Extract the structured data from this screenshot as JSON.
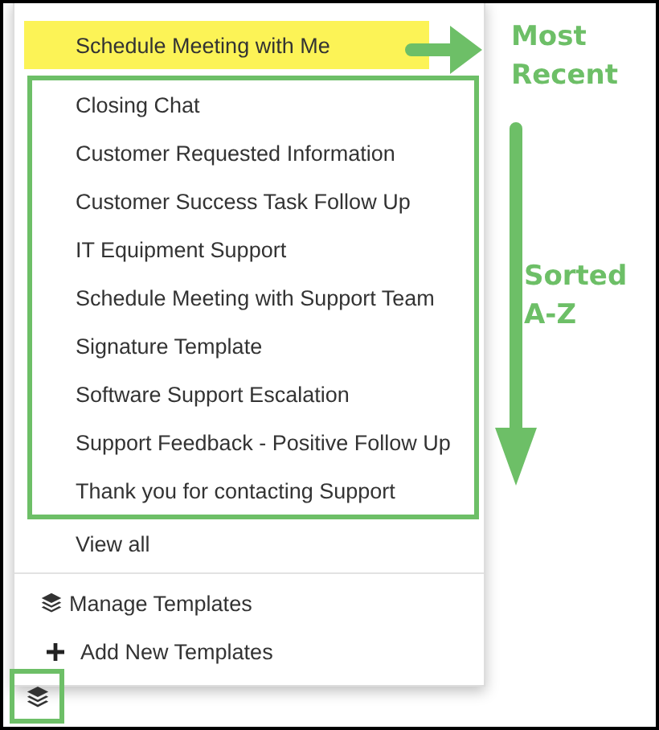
{
  "menu": {
    "recent": [
      {
        "label": "Schedule Meeting with Me",
        "highlighted": true
      }
    ],
    "sorted": [
      {
        "label": "Closing Chat"
      },
      {
        "label": "Customer Requested Information"
      },
      {
        "label": "Customer Success Task Follow Up"
      },
      {
        "label": "IT Equipment Support"
      },
      {
        "label": "Schedule Meeting with Support Team"
      },
      {
        "label": "Signature Template"
      },
      {
        "label": "Software Support Escalation"
      },
      {
        "label": "Support Feedback - Positive Follow Up"
      },
      {
        "label": "Thank you for contacting Support"
      }
    ],
    "view_all": "View all",
    "actions": [
      {
        "kind": "layers",
        "label": "Manage Templates"
      },
      {
        "kind": "plus",
        "label": "Add New Templates"
      }
    ]
  },
  "annotations": {
    "recent": "Most Recent",
    "sorted": "Sorted A-Z"
  }
}
